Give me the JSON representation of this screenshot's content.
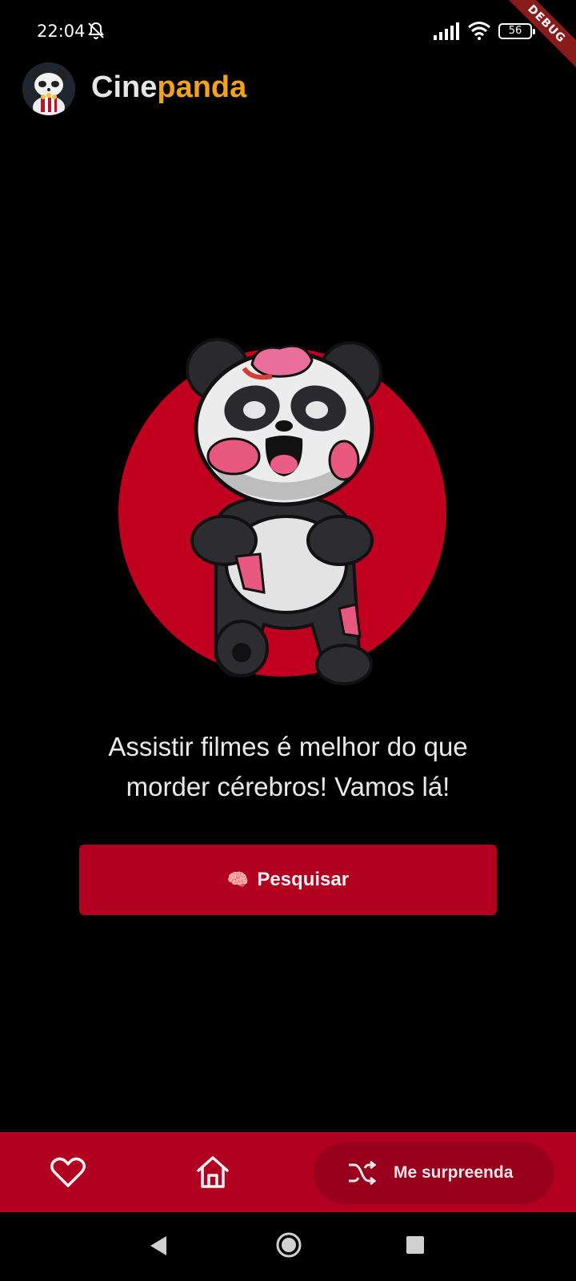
{
  "status_bar": {
    "time": "22:04",
    "battery": "56",
    "debug_label": "DEBUG",
    "icons": [
      "bell-off-icon",
      "signal-icon",
      "wifi-icon",
      "battery-icon"
    ]
  },
  "header": {
    "brand_part1": "Cine",
    "brand_part2": "panda",
    "logo_icon": "panda-popcorn-logo"
  },
  "hero": {
    "image": "zombie-panda-illustration",
    "tagline_line1": "Assistir filmes é melhor do que",
    "tagline_line2": "morder cérebros! Vamos lá!"
  },
  "search_button": {
    "emoji": "🧠",
    "label": "Pesquisar"
  },
  "bottom_nav": {
    "items": [
      {
        "icon": "heart-icon"
      },
      {
        "icon": "home-icon"
      },
      {
        "icon": "shuffle-icon",
        "label": "Me surpreenda"
      }
    ]
  },
  "colors": {
    "accent": "#b10020",
    "accent_dark": "#99001b",
    "brand_orange": "#f3a21d",
    "background": "#000000"
  }
}
